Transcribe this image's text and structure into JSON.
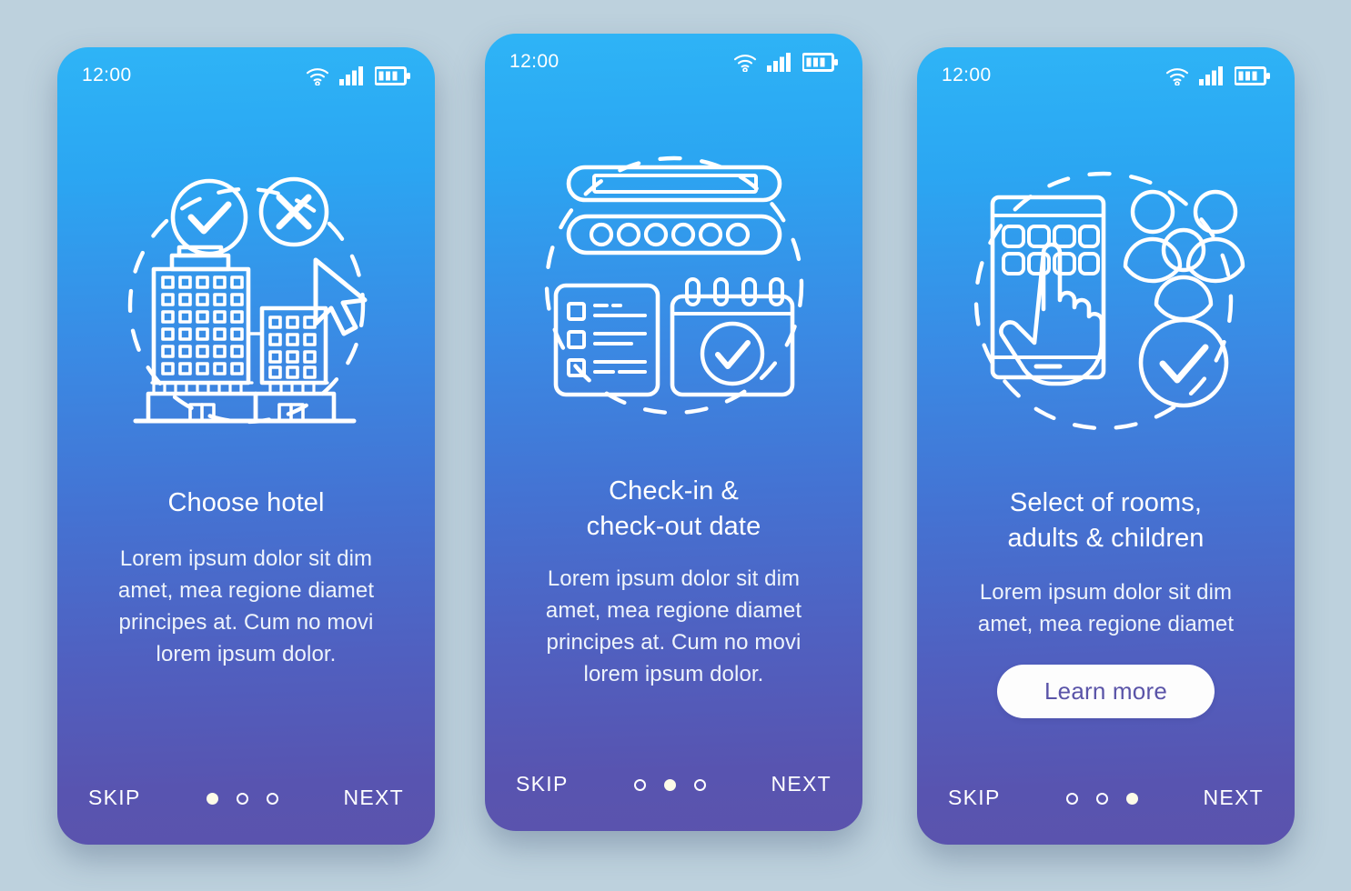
{
  "background_color": "#bdd1dd",
  "screen_gradient": {
    "top": "#2eb4f6",
    "bottom": "#5b53ad"
  },
  "statusbar": {
    "time": "12:00",
    "icons": [
      "wifi-icon",
      "cellular-signal-icon",
      "battery-icon"
    ]
  },
  "nav": {
    "skip_label": "SKIP",
    "next_label": "NEXT",
    "dot_count": 3
  },
  "screens": [
    {
      "id": "choose-hotel",
      "illustration": "hotel-buildings-with-approve-reject-icon",
      "title": "Choose hotel",
      "body": "Lorem ipsum dolor sit dim amet, mea regione diamet principes at. Cum no movi lorem ipsum dolor.",
      "cta_label": null,
      "active_dot": 1
    },
    {
      "id": "check-in-check-out-date",
      "illustration": "booking-form-and-calendar-icon",
      "title": "Check-in &\ncheck-out date",
      "body": "Lorem ipsum dolor sit dim amet, mea regione diamet principes at. Cum no movi lorem ipsum dolor.",
      "cta_label": null,
      "active_dot": 2
    },
    {
      "id": "select-rooms-adults-children",
      "illustration": "smartphone-tap-people-approved-icon",
      "title": "Select of rooms,\nadults & children",
      "body": "Lorem ipsum dolor sit dim amet, mea regione diamet",
      "cta_label": "Learn more",
      "active_dot": 3
    }
  ]
}
